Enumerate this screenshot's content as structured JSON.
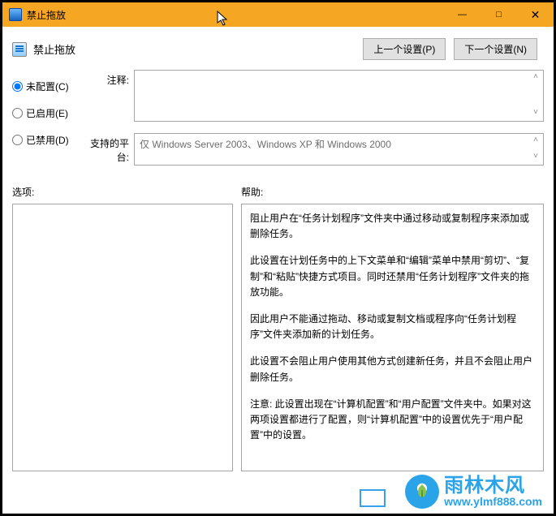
{
  "window": {
    "title": "禁止拖放",
    "min": "—",
    "max": "□",
    "close": "✕"
  },
  "header": {
    "title": "禁止拖放",
    "prev_btn": "上一个设置(P)",
    "next_btn": "下一个设置(N)"
  },
  "radios": {
    "not_configured": "未配置(C)",
    "enabled": "已启用(E)",
    "disabled": "已禁用(D)",
    "selected": "not_configured"
  },
  "fields": {
    "comment_label": "注释:",
    "comment_value": "",
    "platform_label": "支持的平台:",
    "platform_value": "仅 Windows Server 2003、Windows XP 和 Windows 2000"
  },
  "lower": {
    "options_label": "选项:",
    "help_label": "帮助:"
  },
  "help": {
    "p1": "阻止用户在“任务计划程序”文件夹中通过移动或复制程序来添加或删除任务。",
    "p2": "此设置在计划任务中的上下文菜单和“编辑”菜单中禁用“剪切”、“复制”和“粘贴”快捷方式项目。同时还禁用“任务计划程序”文件夹的拖放功能。",
    "p3": "因此用户不能通过拖动、移动或复制文档或程序向“任务计划程序”文件夹添加新的计划任务。",
    "p4": "此设置不会阻止用户使用其他方式创建新任务，并且不会阻止用户删除任务。",
    "p5": "注意: 此设置出现在“计算机配置”和“用户配置”文件夹中。如果对这两项设置都进行了配置，则“计算机配置”中的设置优先于“用户配置”中的设置。"
  },
  "watermark": {
    "cn": "雨林木风",
    "url": "www.ylmf888.com"
  }
}
